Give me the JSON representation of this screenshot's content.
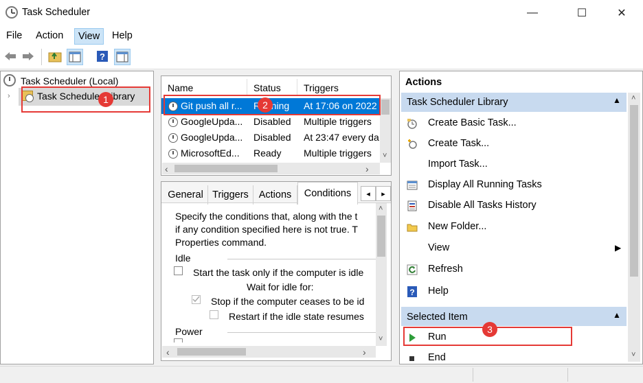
{
  "window": {
    "title": "Task Scheduler",
    "minimize": "—",
    "maximize": "☐",
    "close": "✕"
  },
  "menu": [
    "File",
    "Action",
    "View",
    "Help"
  ],
  "tree": {
    "root": "Task Scheduler (Local)",
    "child": "Task Scheduler Library"
  },
  "tasks": {
    "columns": [
      "Name",
      "Status",
      "Triggers"
    ],
    "rows": [
      {
        "name": "Git push all r...",
        "status": "Running",
        "triggers": "At 17:06 on 2022"
      },
      {
        "name": "GoogleUpda...",
        "status": "Disabled",
        "triggers": "Multiple triggers"
      },
      {
        "name": "GoogleUpda...",
        "status": "Disabled",
        "triggers": "At 23:47 every da"
      },
      {
        "name": "MicrosoftEd...",
        "status": "Ready",
        "triggers": "Multiple triggers"
      }
    ]
  },
  "details": {
    "tabs": [
      "General",
      "Triggers",
      "Actions",
      "Conditions"
    ],
    "active_tab": "Conditions",
    "text_line1": "Specify the conditions that, along with the t",
    "text_line2": "if any condition specified here is not true.  T",
    "text_line3": "Properties command.",
    "idle_label": "Idle",
    "start_idle": "Start the task only if the computer is idle",
    "wait_idle": "Wait for idle for:",
    "stop_idle": "Stop if the computer ceases to be id",
    "restart_idle": "Restart if the idle state resumes",
    "power_label": "Power"
  },
  "actions": {
    "header": "Actions",
    "section1": "Task Scheduler Library",
    "items1": [
      {
        "label": "Create Basic Task...",
        "icon": "create-basic-task-icon"
      },
      {
        "label": "Create Task...",
        "icon": "create-task-icon"
      },
      {
        "label": "Import Task...",
        "icon": ""
      },
      {
        "label": "Display All Running Tasks",
        "icon": "running-tasks-icon"
      },
      {
        "label": "Disable All Tasks History",
        "icon": "history-icon"
      },
      {
        "label": "New Folder...",
        "icon": "folder-icon"
      },
      {
        "label": "View",
        "icon": ""
      },
      {
        "label": "Refresh",
        "icon": "refresh-icon"
      },
      {
        "label": "Help",
        "icon": "help-icon"
      }
    ],
    "section2": "Selected Item",
    "items2": [
      {
        "label": "Run",
        "icon": "run-icon"
      },
      {
        "label": "End",
        "icon": "end-icon"
      }
    ]
  },
  "annotations": {
    "one": "1",
    "two": "2",
    "three": "3"
  },
  "colors": {
    "selection": "#0078d7",
    "annotation": "#e53935",
    "section_header": "#c8daef"
  }
}
